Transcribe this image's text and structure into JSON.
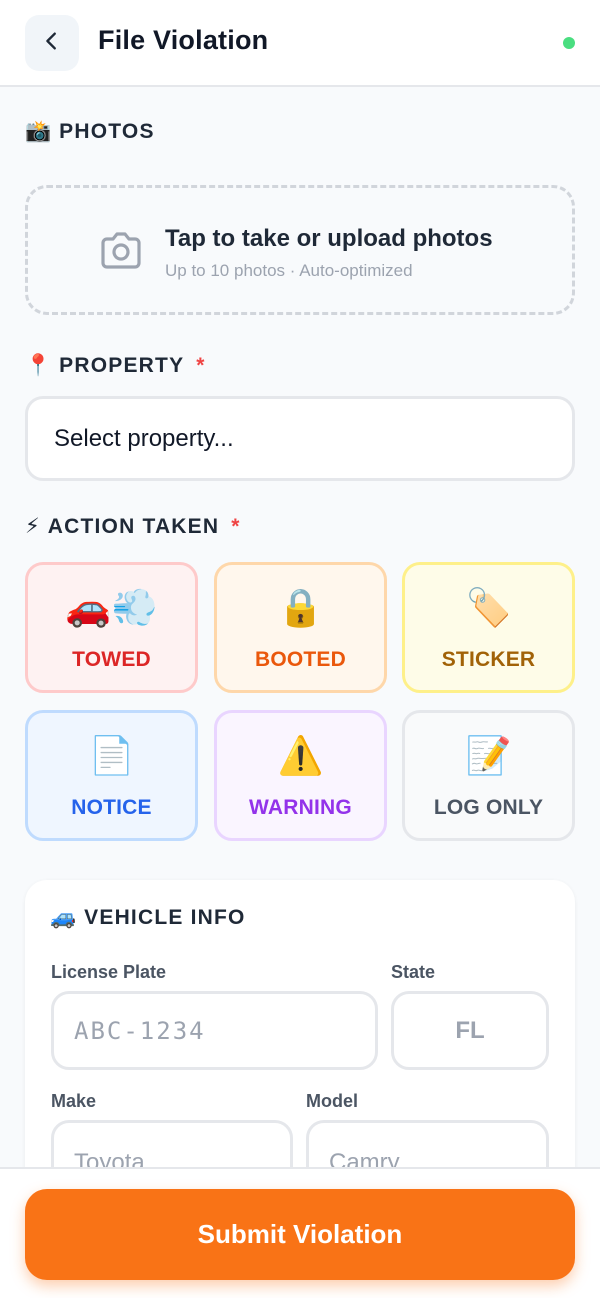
{
  "header": {
    "title": "File Violation",
    "back_icon": "chevron-left-icon",
    "status_color": "#4ade80"
  },
  "photos": {
    "label": "PHOTOS",
    "emoji": "📸",
    "upload_title": "Tap to take or upload photos",
    "upload_subtitle": "Up to 10 photos · Auto-optimized",
    "icon": "camera-icon"
  },
  "property": {
    "label": "PROPERTY",
    "emoji": "📍",
    "required_mark": "*",
    "placeholder": "Select property..."
  },
  "action": {
    "label": "ACTION TAKEN",
    "emoji": "⚡",
    "required_mark": "*",
    "options": [
      {
        "key": "towed",
        "emoji": "🚗💨",
        "label": "TOWED",
        "text_color": "#dc2626",
        "border": "#fecaca",
        "bg": "#fef2f2"
      },
      {
        "key": "booted",
        "emoji": "🔒",
        "label": "BOOTED",
        "text_color": "#ea580c",
        "border": "#fed7aa",
        "bg": "#fff7ed"
      },
      {
        "key": "sticker",
        "emoji": "🏷️",
        "label": "STICKER",
        "text_color": "#a16207",
        "border": "#fef08a",
        "bg": "#fefce8"
      },
      {
        "key": "notice",
        "emoji": "📄",
        "label": "NOTICE",
        "text_color": "#2563eb",
        "border": "#bfdbfe",
        "bg": "#eff6ff"
      },
      {
        "key": "warning",
        "emoji": "⚠️",
        "label": "WARNING",
        "text_color": "#9333ea",
        "border": "#e9d5ff",
        "bg": "#faf5ff"
      },
      {
        "key": "log-only",
        "emoji": "📝",
        "label": "LOG ONLY",
        "text_color": "#4b5563",
        "border": "#e5e7eb",
        "bg": "#f9fafb"
      }
    ]
  },
  "vehicle": {
    "label": "VEHICLE INFO",
    "emoji": "🚙",
    "plate_label": "License Plate",
    "plate_placeholder": "ABC-1234",
    "state_label": "State",
    "state_placeholder": "FL",
    "make_label": "Make",
    "make_placeholder": "Toyota",
    "model_label": "Model",
    "model_placeholder": "Camry"
  },
  "footer": {
    "submit_label": "Submit Violation",
    "accent": "#f97316"
  }
}
